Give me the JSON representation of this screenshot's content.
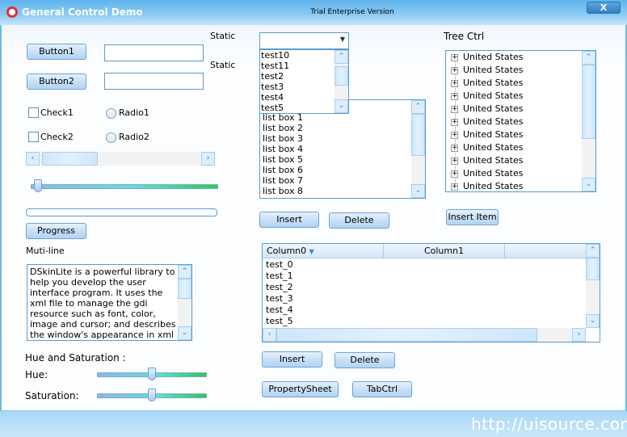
{
  "window": {
    "title": "General Control Demo",
    "edition": "Trial Enterprise Version",
    "close_label": "X",
    "footer_url": "http://uisource.com"
  },
  "buttons": {
    "button1": "Button1",
    "button2": "Button2",
    "progress": "Progress",
    "insert": "Insert",
    "delete": "Delete",
    "insert_item": "Insert Item",
    "list_insert": "Insert",
    "list_delete": "Delete",
    "property_sheet": "PropertySheet",
    "tab_ctrl": "TabCtrl"
  },
  "edits": {
    "edit1": "",
    "edit2": ""
  },
  "statics": {
    "static1": "Static",
    "static2": "Static"
  },
  "checks": [
    {
      "label": "Check1",
      "checked": false
    },
    {
      "label": "Check2",
      "checked": false
    }
  ],
  "radios": [
    {
      "label": "Radio1",
      "selected": false
    },
    {
      "label": "Radio2",
      "selected": false
    }
  ],
  "slider_main": {
    "value_percent": 2
  },
  "progress": {
    "value_percent": 0
  },
  "multiline": {
    "label": "Muti-line",
    "text": "DSkinLite is a powerful library to help you develop the user interface program. It uses the xml file to manage the gdi resource such as font, color, image and cursor; and describes the window's appearance in xml file. Basis of the rule, you can"
  },
  "hue_sat": {
    "label": "Hue and Saturation :",
    "hue_label": "Hue:",
    "saturation_label": "Saturation:",
    "hue_percent": 50,
    "saturation_percent": 50
  },
  "combo": {
    "value": "",
    "dropdown_items": [
      "test10",
      "test11",
      "test2",
      "test3",
      "test4",
      "test5"
    ]
  },
  "listbox": {
    "items": [
      "list box 1",
      "list box 2",
      "list box 3",
      "list box 4",
      "list box 5",
      "list box 6",
      "list box 7",
      "list box 8"
    ]
  },
  "tree": {
    "label": "Tree Ctrl",
    "items": [
      "United States",
      "United States",
      "United States",
      "United States",
      "United States",
      "United States",
      "United States",
      "United States",
      "United States",
      "United States",
      "United States"
    ]
  },
  "listctrl": {
    "columns": [
      "Column0",
      "Column1"
    ],
    "rows": [
      "test_0",
      "test_1",
      "test_2",
      "test_3",
      "test_4",
      "test_5"
    ]
  },
  "colors": {
    "accent": "#5b9bd1",
    "titlebar": "#5fb4ec"
  }
}
